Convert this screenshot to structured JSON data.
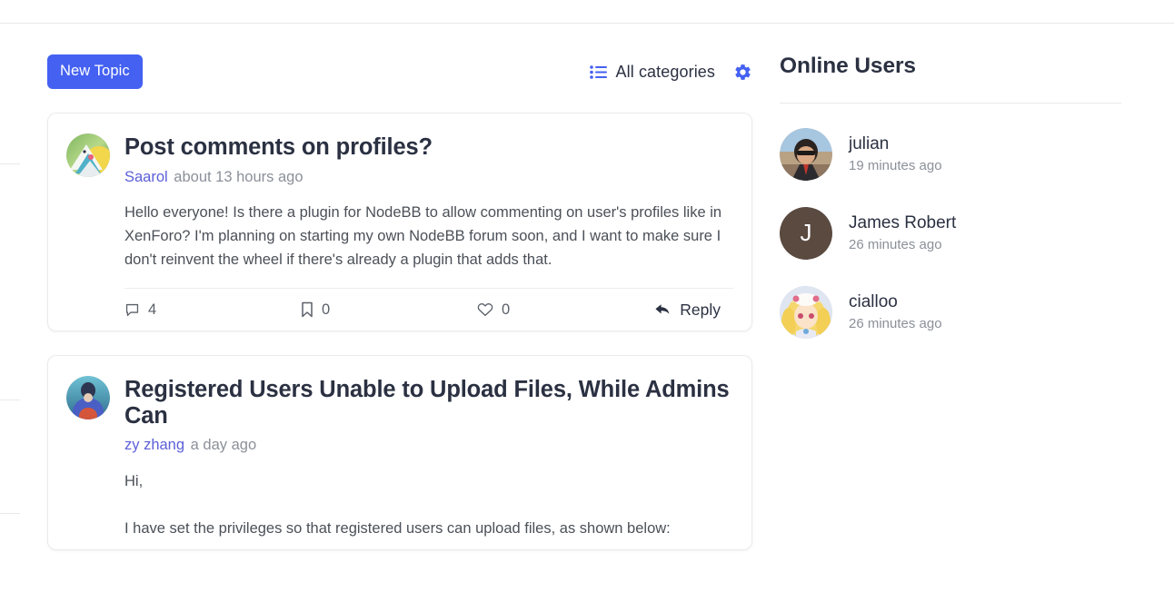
{
  "toolbar": {
    "new_topic_label": "New Topic",
    "category_label": "All categories",
    "list_icon": "list-icon",
    "gear_icon": "gear-icon"
  },
  "topics": [
    {
      "title": "Post comments on profiles?",
      "author": "Saarol",
      "timestamp": "about 13 hours ago",
      "avatar": "saarol-avatar",
      "body": [
        "Hello everyone! Is there a plugin for NodeBB to allow commenting on user's profiles like in XenForo? I'm planning on starting my own NodeBB forum soon, and I want to make sure I don't reinvent the wheel if there's already a plugin that adds that."
      ],
      "actions": {
        "comments_count": "4",
        "bookmarks_count": "0",
        "likes_count": "0",
        "reply_label": "Reply"
      }
    },
    {
      "title": "Registered Users Unable to Upload Files, While Admins Can",
      "author": "zy zhang",
      "timestamp": "a day ago",
      "avatar": "zy-zhang-avatar",
      "body": [
        "Hi,",
        "I have set the privileges so that registered users can upload files, as shown below:"
      ]
    }
  ],
  "sidebar": {
    "title": "Online Users",
    "users": [
      {
        "name": "julian",
        "when": "19 minutes ago",
        "avatar_type": "photo",
        "avatar": "julian-avatar"
      },
      {
        "name": "James Robert",
        "when": "26 minutes ago",
        "avatar_type": "letter",
        "letter": "J",
        "color": "#5a4a40"
      },
      {
        "name": "cialloo",
        "when": "26 minutes ago",
        "avatar_type": "photo",
        "avatar": "cialloo-avatar"
      }
    ]
  },
  "colors": {
    "accent": "#4461f2",
    "link": "#5b5fd8",
    "text": "#2b3142",
    "muted": "#8b9099",
    "body_text": "#4b5058",
    "border": "#ebebef"
  }
}
